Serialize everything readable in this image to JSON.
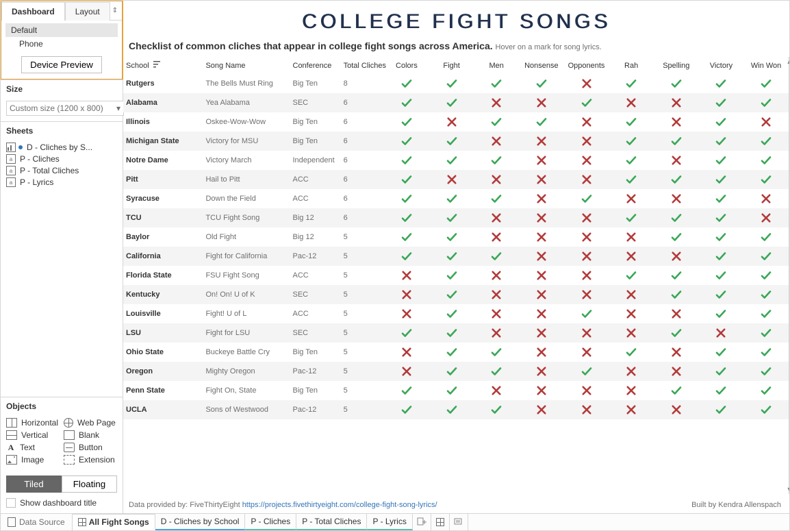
{
  "side": {
    "tabs": {
      "dashboard": "Dashboard",
      "layout": "Layout"
    },
    "devices": {
      "default": "Default",
      "phone": "Phone",
      "preview_btn": "Device Preview"
    },
    "size": {
      "header": "Size",
      "value": "Custom size (1200 x 800)"
    },
    "sheets": {
      "header": "Sheets",
      "items": [
        {
          "label": "D - Cliches by S...",
          "icon": "bar",
          "dot": true
        },
        {
          "label": "P - Cliches",
          "icon": "text",
          "dot": false
        },
        {
          "label": "P - Total Cliches",
          "icon": "text",
          "dot": false
        },
        {
          "label": "P - Lyrics",
          "icon": "text",
          "dot": false
        }
      ]
    },
    "objects": {
      "header": "Objects",
      "items": [
        {
          "label": "Horizontal",
          "ico": "horizontal"
        },
        {
          "label": "Web Page",
          "ico": "web"
        },
        {
          "label": "Vertical",
          "ico": "vertical"
        },
        {
          "label": "Blank",
          "ico": "blank"
        },
        {
          "label": "Text",
          "ico": "text"
        },
        {
          "label": "Button",
          "ico": "button"
        },
        {
          "label": "Image",
          "ico": "image"
        },
        {
          "label": "Extension",
          "ico": "ext"
        }
      ]
    },
    "seg": {
      "tiled": "Tiled",
      "floating": "Floating"
    },
    "show_title": "Show dashboard title"
  },
  "dash": {
    "title": "COLLEGE FIGHT SONGS",
    "subtitle": "Checklist of common cliches that appear in college fight songs across America.",
    "hint": "Hover on a mark for song lyrics.",
    "columns": [
      "School",
      "Song Name",
      "Conference",
      "Total Cliches",
      "Colors",
      "Fight",
      "Men",
      "Nonsense",
      "Opponents",
      "Rah",
      "Spelling",
      "Victory",
      "Win Won"
    ],
    "rows": [
      {
        "school": "Rutgers",
        "song": "The Bells Must Ring",
        "conf": "Big Ten",
        "total": "8",
        "m": [
          "y",
          "y",
          "y",
          "y",
          "n",
          "y",
          "y",
          "y",
          "y"
        ]
      },
      {
        "school": "Alabama",
        "song": "Yea Alabama",
        "conf": "SEC",
        "total": "6",
        "m": [
          "y",
          "y",
          "n",
          "n",
          "y",
          "n",
          "n",
          "y",
          "y"
        ]
      },
      {
        "school": "Illinois",
        "song": "Oskee-Wow-Wow",
        "conf": "Big Ten",
        "total": "6",
        "m": [
          "y",
          "n",
          "y",
          "y",
          "n",
          "y",
          "n",
          "y",
          "n"
        ]
      },
      {
        "school": "Michigan State",
        "song": "Victory for MSU",
        "conf": "Big Ten",
        "total": "6",
        "m": [
          "y",
          "y",
          "n",
          "n",
          "n",
          "y",
          "y",
          "y",
          "y"
        ]
      },
      {
        "school": "Notre Dame",
        "song": "Victory March",
        "conf": "Independent",
        "total": "6",
        "m": [
          "y",
          "y",
          "y",
          "n",
          "n",
          "y",
          "n",
          "y",
          "y"
        ]
      },
      {
        "school": "Pitt",
        "song": "Hail to Pitt",
        "conf": "ACC",
        "total": "6",
        "m": [
          "y",
          "n",
          "n",
          "n",
          "n",
          "y",
          "y",
          "y",
          "y"
        ]
      },
      {
        "school": "Syracuse",
        "song": "Down the Field",
        "conf": "ACC",
        "total": "6",
        "m": [
          "y",
          "y",
          "y",
          "n",
          "y",
          "n",
          "n",
          "y",
          "n"
        ]
      },
      {
        "school": "TCU",
        "song": "TCU Fight Song",
        "conf": "Big 12",
        "total": "6",
        "m": [
          "y",
          "y",
          "n",
          "n",
          "n",
          "y",
          "y",
          "y",
          "n"
        ]
      },
      {
        "school": "Baylor",
        "song": "Old Fight",
        "conf": "Big 12",
        "total": "5",
        "m": [
          "y",
          "y",
          "n",
          "n",
          "n",
          "n",
          "y",
          "y",
          "y"
        ]
      },
      {
        "school": "California",
        "song": "Fight for California",
        "conf": "Pac-12",
        "total": "5",
        "m": [
          "y",
          "y",
          "y",
          "n",
          "n",
          "n",
          "n",
          "y",
          "y"
        ]
      },
      {
        "school": "Florida State",
        "song": "FSU Fight Song",
        "conf": "ACC",
        "total": "5",
        "m": [
          "n",
          "y",
          "n",
          "n",
          "n",
          "y",
          "y",
          "y",
          "y"
        ]
      },
      {
        "school": "Kentucky",
        "song": "On! On! U of K",
        "conf": "SEC",
        "total": "5",
        "m": [
          "n",
          "y",
          "n",
          "n",
          "n",
          "n",
          "y",
          "y",
          "y"
        ]
      },
      {
        "school": "Louisville",
        "song": "Fight! U of L",
        "conf": "ACC",
        "total": "5",
        "m": [
          "n",
          "y",
          "n",
          "n",
          "y",
          "n",
          "n",
          "y",
          "y"
        ]
      },
      {
        "school": "LSU",
        "song": "Fight for LSU",
        "conf": "SEC",
        "total": "5",
        "m": [
          "y",
          "y",
          "n",
          "n",
          "n",
          "n",
          "y",
          "n",
          "y"
        ]
      },
      {
        "school": "Ohio State",
        "song": "Buckeye Battle Cry",
        "conf": "Big Ten",
        "total": "5",
        "m": [
          "n",
          "y",
          "y",
          "n",
          "n",
          "y",
          "n",
          "y",
          "y"
        ]
      },
      {
        "school": "Oregon",
        "song": "Mighty Oregon",
        "conf": "Pac-12",
        "total": "5",
        "m": [
          "n",
          "y",
          "y",
          "n",
          "y",
          "n",
          "n",
          "y",
          "y"
        ]
      },
      {
        "school": "Penn State",
        "song": "Fight On, State",
        "conf": "Big Ten",
        "total": "5",
        "m": [
          "y",
          "y",
          "n",
          "n",
          "n",
          "n",
          "y",
          "y",
          "y"
        ]
      },
      {
        "school": "UCLA",
        "song": "Sons of Westwood",
        "conf": "Pac-12",
        "total": "5",
        "m": [
          "y",
          "y",
          "y",
          "n",
          "n",
          "n",
          "n",
          "y",
          "y"
        ]
      }
    ],
    "credits": {
      "left_prefix": "Data provided by: FiveThirtyEight ",
      "link_text": "https://projects.fivethirtyeight.com/college-fight-song-lyrics/",
      "right": "Built by Kendra Allenspach"
    }
  },
  "bottom": {
    "data_source": "Data Source",
    "tabs": [
      {
        "label": "All Fight Songs",
        "type": "dash",
        "active": true,
        "underline": ""
      },
      {
        "label": "D - Cliches by School",
        "type": "ws",
        "active": false,
        "underline": "blue"
      },
      {
        "label": "P - Cliches",
        "type": "ws",
        "active": false,
        "underline": "teal"
      },
      {
        "label": "P - Total Cliches",
        "type": "ws",
        "active": false,
        "underline": "teal"
      },
      {
        "label": "P - Lyrics",
        "type": "ws",
        "active": false,
        "underline": "teal"
      }
    ]
  }
}
